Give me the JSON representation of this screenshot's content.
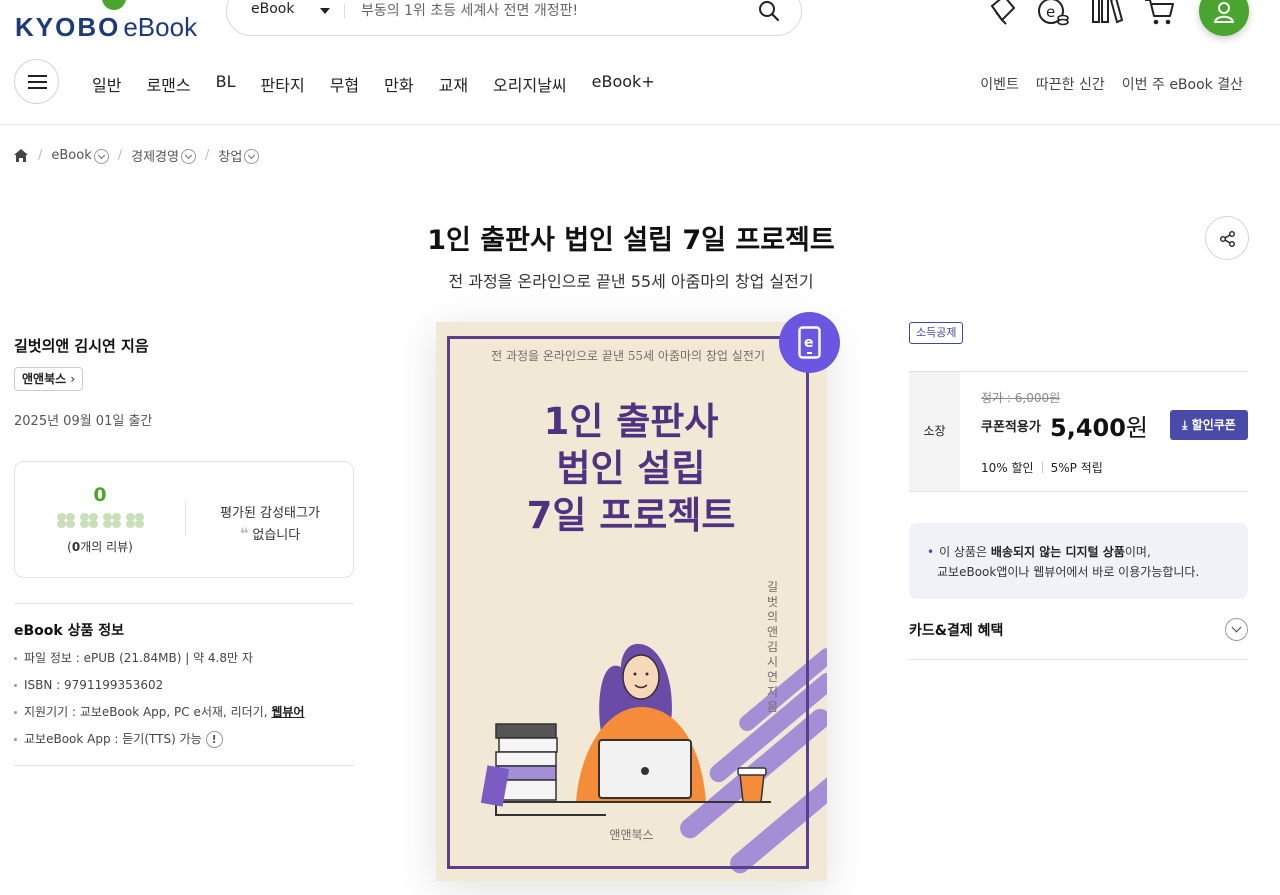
{
  "header": {
    "logo_kyobo": "KYOBO",
    "logo_ebook": "eBook",
    "search_category": "eBook",
    "search_placeholder": "부동의 1위 초등 세계사 전면 개정판!"
  },
  "nav": {
    "items": [
      "일반",
      "로맨스",
      "BL",
      "판타지",
      "무협",
      "만화",
      "교재",
      "오리지날씨",
      "eBook+"
    ],
    "right_items": [
      "이벤트",
      "따끈한 신간",
      "이번 주 eBook 결산"
    ]
  },
  "breadcrumb": [
    "eBook",
    "경제경영",
    "창업"
  ],
  "product": {
    "title": "1인 출판사 법인 설립 7일 프로젝트",
    "subtitle": "전 과정을 온라인으로 끝낸 55세 아줌마의 창업 실전기",
    "author": "길벗의앤 김시연 지음",
    "publisher": "앤앤북스",
    "pub_date": "2025년 09월 01일 출간"
  },
  "review": {
    "score": "0",
    "count_text": "(0개의 리뷰)",
    "count_num": "0",
    "count_suffix": "개의 리뷰)",
    "emotion_line1": "평가된 감성태그가",
    "emotion_line2": "없습니다"
  },
  "info": {
    "title": "eBook 상품 정보",
    "file": "파일 정보 : ePUB (21.84MB)   |  약 4.8만 자",
    "isbn": "ISBN : 9791199353602",
    "devices_prefix": "지원기기 : 교보eBook App, PC e서재, 리더기, ",
    "devices_link": "웹뷰어",
    "tts": "교보eBook App : 듣기(TTS) 가능",
    "tts_bang": "!"
  },
  "cover": {
    "subtitle": "전 과정을 온라인으로 끝낸 55세 아줌마의 창업 실전기",
    "title_l1": "1인 출판사",
    "title_l2": "법인 설립",
    "title_l3": "7일 프로젝트",
    "author": "길벗의 앤 김시연 지음",
    "publisher": "앤앤북스",
    "badge_letter": "e"
  },
  "price": {
    "tax_tag": "소득공제",
    "own_label": "소장",
    "original": "정가 : 6,000원",
    "coupon_label": "쿠폰적용가",
    "sale": "5,400",
    "sale_unit": "원",
    "coupon_button": "할인쿠폰",
    "discount": "10% 할인",
    "points": "5%P 적립"
  },
  "notice": {
    "line1_pre": "이 상품은 ",
    "line1_bold": "배송되지 않는 디지털 상품",
    "line1_post": "이며,",
    "line2": "교보eBook앱이나 웹뷰어에서 바로 이용가능합니다."
  },
  "benefit": {
    "label": "카드&결제 혜택"
  },
  "colors": {
    "brand_navy": "#1d3a7a",
    "brand_green": "#4aa52e",
    "coupon_purple": "#4a4ba9",
    "cover_purple": "#4d3380",
    "badge_purple": "#6a56e0"
  }
}
